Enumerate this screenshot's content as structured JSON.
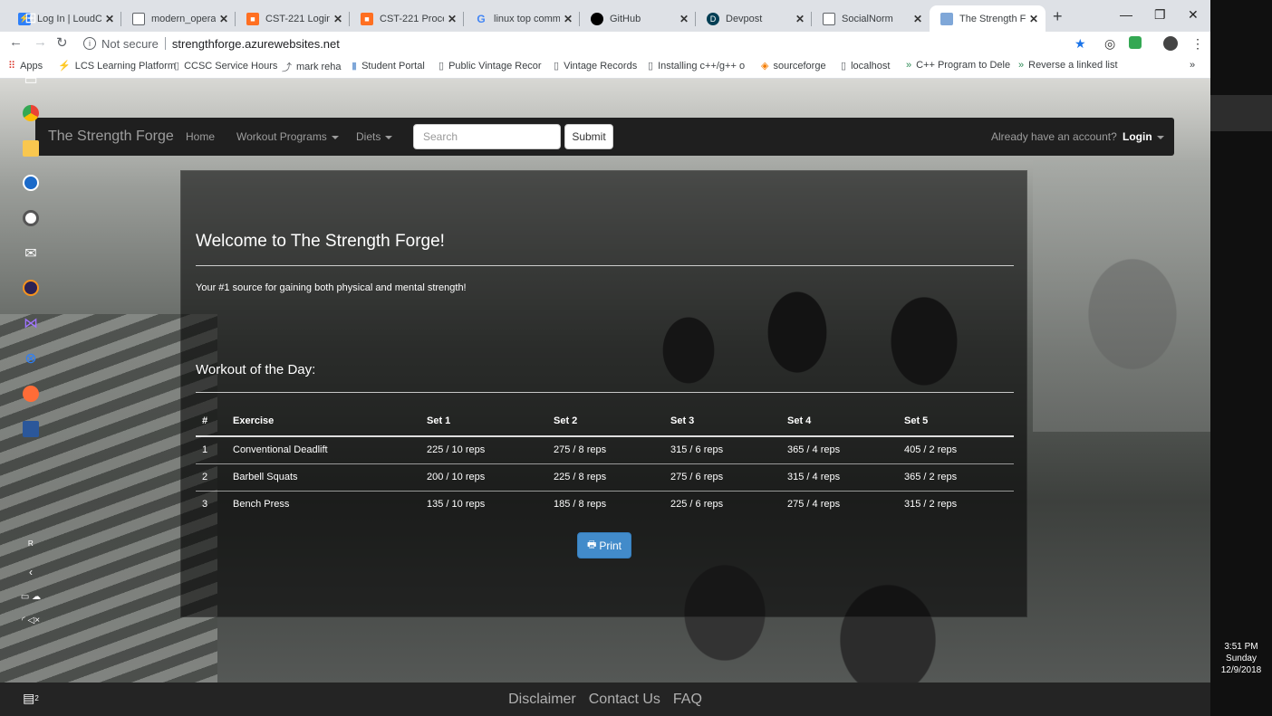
{
  "browser": {
    "tabs": [
      {
        "title": "Log In | LoudClo",
        "icon": "loudcloud-icon",
        "color": "#2d7ff9"
      },
      {
        "title": "modern_operatin",
        "icon": "document-icon",
        "color": "#ffffff"
      },
      {
        "title": "CST-221 Login M",
        "icon": "gcu-icon",
        "color": "#ff6f21"
      },
      {
        "title": "CST-221 Process",
        "icon": "gcu-icon",
        "color": "#ff6f21"
      },
      {
        "title": "linux top comma",
        "icon": "google-icon",
        "color": "#4285f4"
      },
      {
        "title": "GitHub",
        "icon": "github-icon",
        "color": "#000000"
      },
      {
        "title": "Devpost",
        "icon": "devpost-icon",
        "color": "#003e54"
      },
      {
        "title": "SocialNorm",
        "icon": "document-icon",
        "color": "#ffffff"
      },
      {
        "title": "The Strength For",
        "icon": "page-icon",
        "color": "#7fa7d8"
      }
    ],
    "address": {
      "security": "Not secure",
      "url": "strengthforge.azurewebsites.net"
    },
    "bookmarks": [
      {
        "label": "Apps",
        "icon": "apps-grid-icon"
      },
      {
        "label": "LCS Learning Platform",
        "icon": "loudcloud-icon"
      },
      {
        "label": "CCSC Service Hours",
        "icon": "document-icon"
      },
      {
        "label": "mark reha",
        "icon": "chart-icon"
      },
      {
        "label": "Student Portal",
        "icon": "portal-icon"
      },
      {
        "label": "Public Vintage Recor",
        "icon": "document-icon"
      },
      {
        "label": "Vintage Records",
        "icon": "document-icon"
      },
      {
        "label": "Installing c++/g++ o",
        "icon": "document-icon"
      },
      {
        "label": "sourceforge",
        "icon": "sourceforge-icon"
      },
      {
        "label": "localhost",
        "icon": "document-icon"
      },
      {
        "label": "C++ Program to Dele",
        "icon": "geeks-icon"
      },
      {
        "label": "Reverse a linked list",
        "icon": "geeks-icon"
      }
    ]
  },
  "navbar": {
    "brand": "The Strength Forge",
    "home": "Home",
    "workout_programs": "Workout Programs",
    "diets": "Diets",
    "search_placeholder": "Search",
    "submit": "Submit",
    "account_prompt": "Already have an account?",
    "login": "Login"
  },
  "main": {
    "welcome": "Welcome to The Strength Forge!",
    "tagline": "Your #1 source for gaining both physical and mental strength!",
    "wod_title": "Workout of the Day:",
    "table": {
      "headers": [
        "#",
        "Exercise",
        "Set 1",
        "Set 2",
        "Set 3",
        "Set 4",
        "Set 5"
      ],
      "rows": [
        [
          "1",
          "Conventional Deadlift",
          "225 / 10 reps",
          "275 / 8 reps",
          "315 / 6 reps",
          "365 / 4 reps",
          "405 / 2 reps"
        ],
        [
          "2",
          "Barbell Squats",
          "200 / 10 reps",
          "225 / 8 reps",
          "275 / 6 reps",
          "315 / 4 reps",
          "365 / 2 reps"
        ],
        [
          "3",
          "Bench Press",
          "135 / 10 reps",
          "185 / 8 reps",
          "225 / 6 reps",
          "275 / 4 reps",
          "315 / 2 reps"
        ]
      ]
    },
    "print": "Print"
  },
  "footer": {
    "links": [
      "Disclaimer",
      "Contact Us",
      "FAQ"
    ]
  },
  "taskbar": {
    "clock": {
      "time": "3:51 PM",
      "day": "Sunday",
      "date": "12/9/2018"
    },
    "apps": [
      "windows-start-icon",
      "cortana-icon",
      "task-view-icon",
      "chrome-icon",
      "file-explorer-icon",
      "steam-icon",
      "github-desktop-icon",
      "mail-icon",
      "eclipse-icon",
      "visual-studio-icon",
      "network-app-icon",
      "postman-icon",
      "word-icon"
    ],
    "notification_count": "2"
  }
}
